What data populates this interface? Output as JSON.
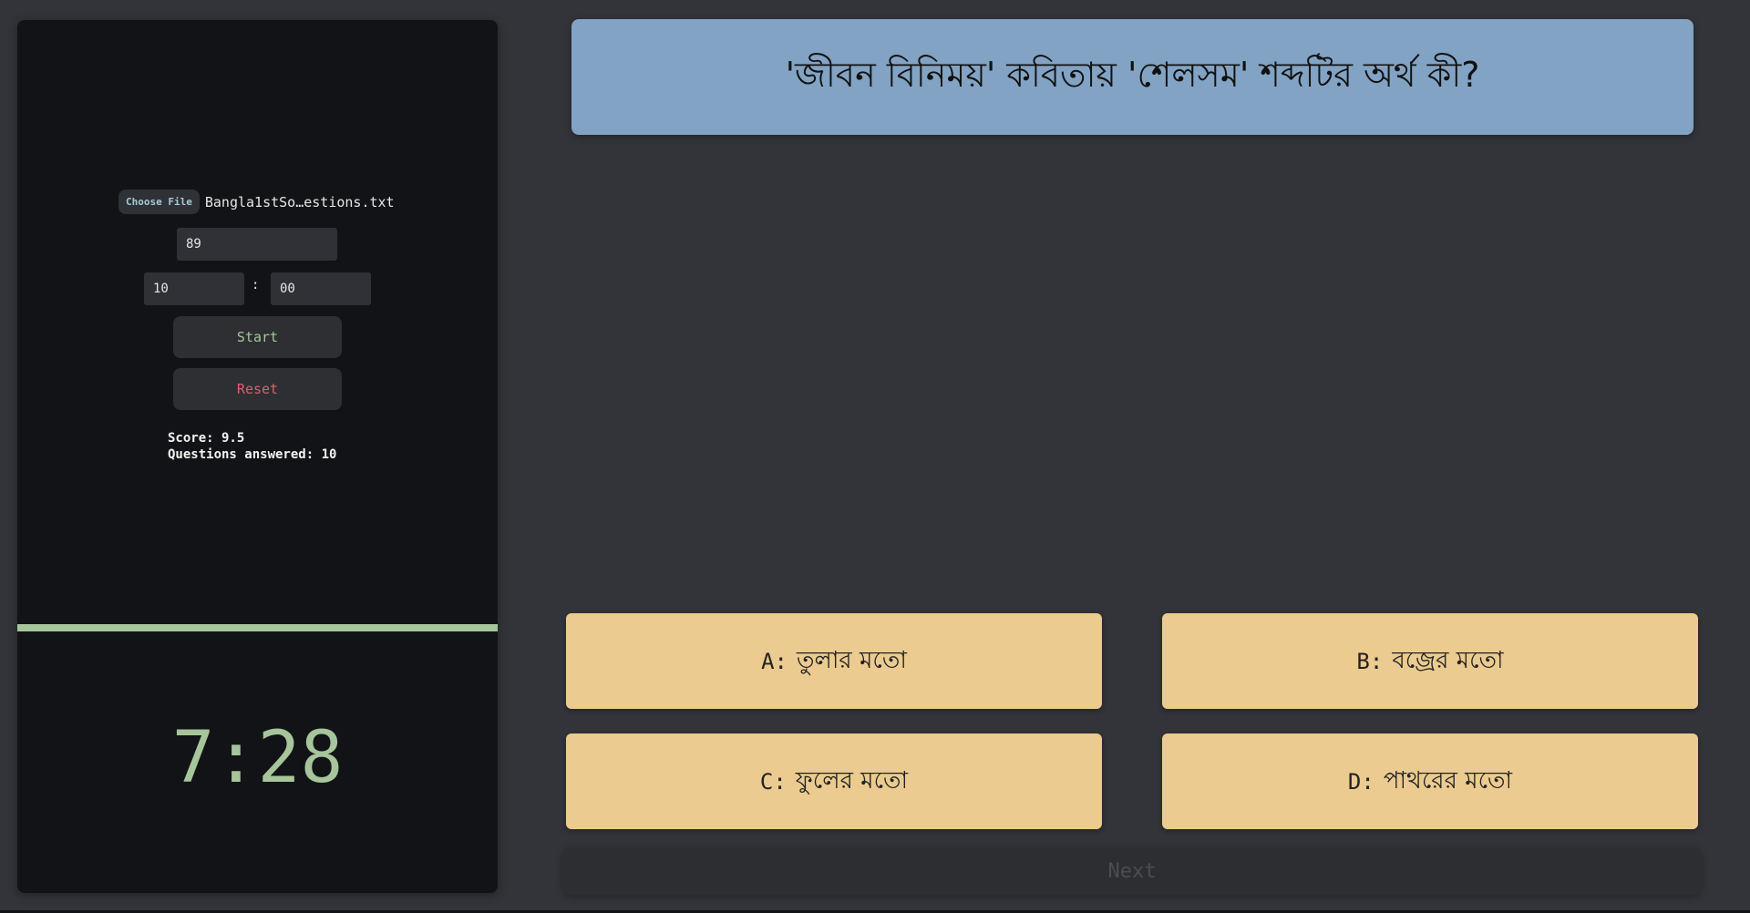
{
  "sidebar": {
    "file_button_label": "Choose File",
    "file_name": "Bangla1stSo…estions.txt",
    "question_count_value": "89",
    "timer_minutes_value": "10",
    "timer_separator": ":",
    "timer_seconds_value": "00",
    "start_label": "Start",
    "reset_label": "Reset",
    "score_text": "Score: 9.5",
    "answered_text": "Questions answered: 10",
    "progress_fraction": 1.0,
    "timer_display": "7:28"
  },
  "question": {
    "text": "'জীবন বিনিময়' কবিতায় 'শেলসম' শব্দটির অর্থ কী?"
  },
  "options": [
    {
      "letter": "A:",
      "text": "তুলার মতো"
    },
    {
      "letter": "B:",
      "text": "বজ্রের মতো"
    },
    {
      "letter": "C:",
      "text": "ফুলের মতো"
    },
    {
      "letter": "D:",
      "text": "পাথরের মতো"
    }
  ],
  "next_label": "Next",
  "colors": {
    "question_bg": "#82a3c3",
    "option_bg": "#ebcb8f",
    "accent_green": "#a6c59b",
    "reset_red": "#d9616c"
  }
}
